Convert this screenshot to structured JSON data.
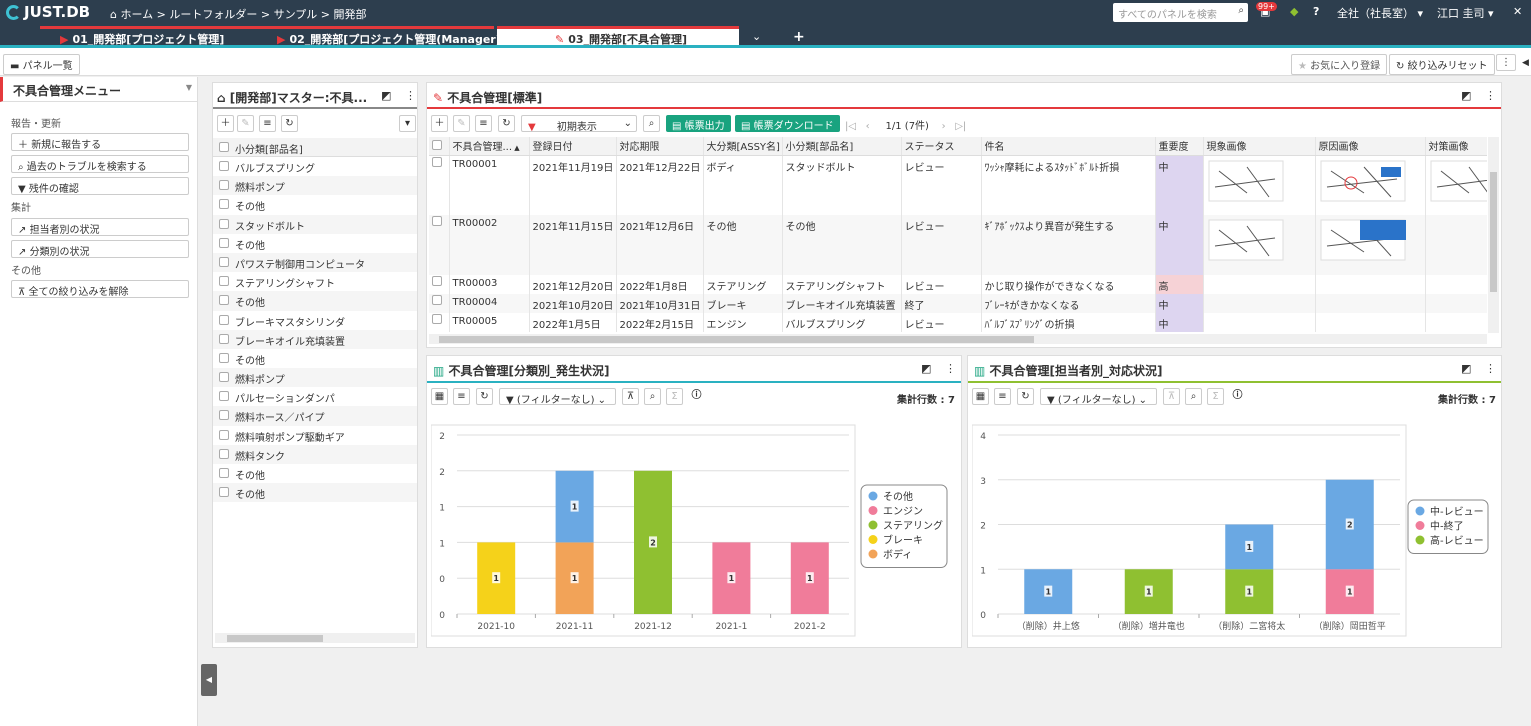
{
  "app": {
    "logo": "JUST.DB",
    "breadcrumb": "ホーム > ルートフォルダー > サンプル > 開発部",
    "search_placeholder": "すべてのパネルを検索",
    "notif_badge": "99+",
    "help": "?",
    "org": "全社（社長室）",
    "user": "江口 圭司"
  },
  "tabs": [
    {
      "label": "01_開発部[プロジェクト管理]"
    },
    {
      "label": "02_開発部[プロジェクト管理(Manager)]"
    },
    {
      "label": "03_開発部[不具合管理]"
    }
  ],
  "toolbar": {
    "panel_list": "パネル一覧",
    "favorite": "お気に入り登録",
    "reset_filter": "絞り込みリセット"
  },
  "left_menu": {
    "title": "不具合管理メニュー",
    "sec1": "報告・更新",
    "btn_new": "新規に報告する",
    "btn_search": "過去のトラブルを検索する",
    "btn_remaining": "残件の確認",
    "sec2": "集計",
    "btn_assignee": "担当者別の状況",
    "btn_category": "分類別の状況",
    "sec3": "その他",
    "btn_clear": "全ての絞り込みを解除"
  },
  "master_panel": {
    "title": "[開発部]マスター:不具...",
    "col": "小分類[部品名]",
    "items": [
      "バルブスプリング",
      "燃料ポンプ",
      "その他",
      "スタッドボルト",
      "その他",
      "パワステ制御用コンピュータ",
      "ステアリングシャフト",
      "その他",
      "ブレーキマスタシリンダ",
      "ブレーキオイル充填装置",
      "その他",
      "燃料ポンプ",
      "パルセーションダンパ",
      "燃料ホース／パイプ",
      "燃料噴射ポンプ駆動ギア",
      "燃料タンク",
      "その他",
      "その他"
    ]
  },
  "main_panel": {
    "title": "不具合管理[標準]",
    "filter": "初期表示",
    "btn_report": "帳票出力",
    "btn_download": "帳票ダウンロード",
    "page": "1/1 (7件)",
    "columns": [
      "不具合管理...",
      "登録日付",
      "対応期限",
      "大分類[ASSY名]",
      "小分類[部品名]",
      "ステータス",
      "件名",
      "重要度",
      "現象画像",
      "原因画像",
      "対策画像"
    ],
    "rows": [
      [
        "TR00001",
        "2021年11月19日",
        "2021年12月22日",
        "ボディ",
        "スタッドボルト",
        "レビュー",
        "ﾜｯｼｬ摩耗によるｽﾀｯﾄﾞﾎﾞﾙﾄ折損",
        "中"
      ],
      [
        "TR00002",
        "2021年11月15日",
        "2021年12月6日",
        "その他",
        "その他",
        "レビュー",
        "ｷﾞｱﾎﾞｯｸｽより異音が発生する",
        "中"
      ],
      [
        "TR00003",
        "2021年12月20日",
        "2022年1月8日",
        "ステアリング",
        "ステアリングシャフト",
        "レビュー",
        "かじ取り操作ができなくなる",
        "高"
      ],
      [
        "TR00004",
        "2021年10月20日",
        "2021年10月31日",
        "ブレーキ",
        "ブレーキオイル充填装置",
        "終了",
        "ﾌﾞﾚｰｷがきかなくなる",
        "中"
      ],
      [
        "TR00005",
        "2022年1月5日",
        "2022年2月15日",
        "エンジン",
        "バルブスプリング",
        "レビュー",
        "ﾊﾞﾙﾌﾞｽﾌﾟﾘﾝｸﾞの折損",
        "中"
      ]
    ],
    "colors": {
      "mid": "#ddd5f0",
      "high": "#f6d2d6"
    }
  },
  "chart1": {
    "title": "不具合管理[分類別_発生状況]",
    "filter": "(フィルターなし)",
    "count": "集計行数 : 7"
  },
  "chart2": {
    "title": "不具合管理[担当者別_対応状況]",
    "filter": "(フィルターなし)",
    "count": "集計行数 : 7"
  },
  "chart_data": [
    {
      "type": "bar",
      "stacked": true,
      "categories": [
        "2021-10",
        "2021-11",
        "2021-12",
        "2021-1",
        "2021-2"
      ],
      "ylim": [
        0,
        2.5
      ],
      "yticks": [
        "0",
        "0",
        "1",
        "1",
        "2",
        "2"
      ],
      "series": [
        {
          "name": "その他",
          "color": "#6aa8e3",
          "values": [
            0,
            1,
            0,
            0,
            0
          ]
        },
        {
          "name": "エンジン",
          "color": "#f07c9a",
          "values": [
            0,
            0,
            0,
            1,
            1
          ]
        },
        {
          "name": "ステアリング",
          "color": "#8fc031",
          "values": [
            0,
            0,
            2,
            0,
            0
          ]
        },
        {
          "name": "ブレーキ",
          "color": "#f5d21a",
          "values": [
            1,
            0,
            0,
            0,
            0
          ]
        },
        {
          "name": "ボディ",
          "color": "#f2a358",
          "values": [
            0,
            1,
            0,
            0,
            0
          ]
        }
      ],
      "stack_order": [
        4,
        3,
        2,
        1,
        0
      ],
      "legend": "right"
    },
    {
      "type": "bar",
      "stacked": true,
      "categories": [
        "（削除）井上悠",
        "（削除）増井竜也",
        "（削除）二宮将太",
        "（削除）岡田哲平"
      ],
      "ylim": [
        0,
        4
      ],
      "yticks": [
        "0",
        "1",
        "2",
        "3",
        "4"
      ],
      "series": [
        {
          "name": "中-レビュー",
          "color": "#6aa8e3",
          "values": [
            1,
            0,
            1,
            2
          ]
        },
        {
          "name": "中-終了",
          "color": "#f07c9a",
          "values": [
            0,
            0,
            0,
            1
          ]
        },
        {
          "name": "高-レビュー",
          "color": "#8fc031",
          "values": [
            0,
            1,
            1,
            0
          ]
        }
      ],
      "stack_order": [
        2,
        1,
        0
      ],
      "legend": "right"
    }
  ]
}
